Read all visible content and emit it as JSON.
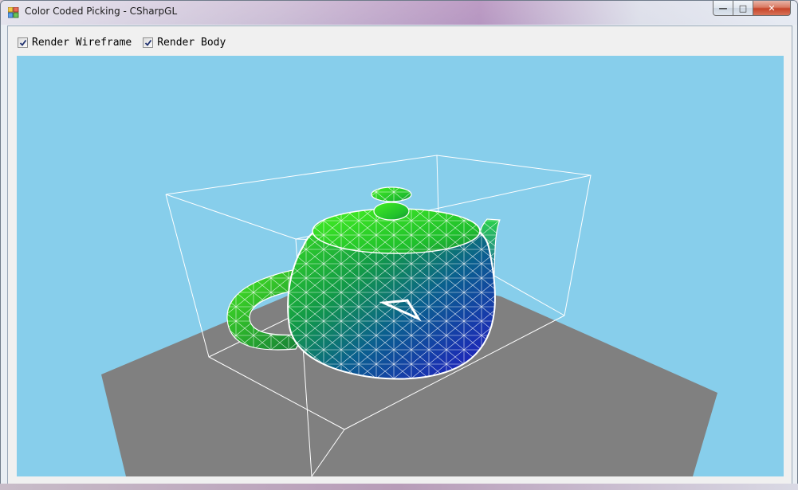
{
  "window": {
    "title": "Color Coded Picking - CSharpGL",
    "app_icon": "app-grid-icon",
    "controls": {
      "minimize": "—",
      "maximize": "□",
      "close": "✕"
    }
  },
  "toolbar": {
    "render_wireframe": {
      "label": "Render Wireframe",
      "checked": true
    },
    "render_body": {
      "label": "Render Body",
      "checked": true
    }
  },
  "viewport": {
    "background_color": "#87ceeb",
    "floor_color": "#808080",
    "wireframe_color": "#ffffff",
    "object": "teapot",
    "object_gradient": [
      "#38e610",
      "#0f6a5a",
      "#2a20d6",
      "#1a16a8"
    ]
  }
}
